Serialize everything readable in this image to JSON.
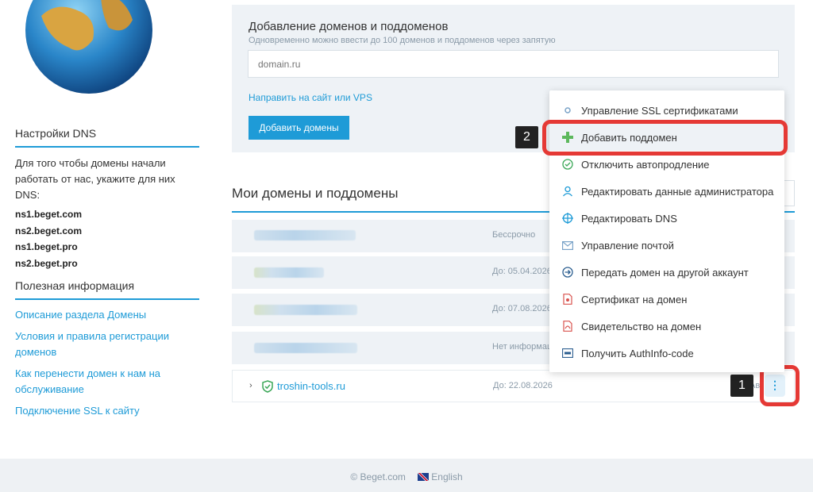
{
  "sidebar": {
    "dns_title": "Настройки DNS",
    "dns_text": "Для того чтобы домены начали работать от нас, укажите для них DNS:",
    "nameservers": [
      "ns1.beget.com",
      "ns2.beget.com",
      "ns1.beget.pro",
      "ns2.beget.pro"
    ],
    "info_title": "Полезная информация",
    "links": [
      "Описание раздела Домены",
      "Условия и правила регистрации доменов",
      "Как перенести домен к нам на обслуживание",
      "Подключение SSL к сайту"
    ]
  },
  "add_panel": {
    "title": "Добавление доменов и поддоменов",
    "subtitle": "Одновременно можно ввести до 100 доменов и поддоменов через запятую",
    "input_placeholder": "domain.ru",
    "redirect_link": "Направить на сайт или VPS",
    "add_button": "Добавить домены"
  },
  "domains": {
    "title": "Мои домены и поддомены",
    "rows": [
      {
        "status": "Бессрочно"
      },
      {
        "status": "До: 05.04.2026"
      },
      {
        "status": "До: 07.08.2026"
      },
      {
        "status": "Нет информации"
      }
    ],
    "last_row": {
      "name": "troshin-tools.ru",
      "status": "До: 22.08.2026",
      "partial": "Авт"
    }
  },
  "menu": {
    "items": [
      {
        "label": "Управление SSL сертификатами",
        "icon": "ssl-icon"
      },
      {
        "label": "Добавить поддомен",
        "icon": "plus-icon"
      },
      {
        "label": "Отключить автопродление",
        "icon": "check-circle-icon"
      },
      {
        "label": "Редактировать данные администратора",
        "icon": "user-icon"
      },
      {
        "label": "Редактировать DNS",
        "icon": "crosshair-icon"
      },
      {
        "label": "Управление почтой",
        "icon": "envelope-icon"
      },
      {
        "label": "Передать домен на другой аккаунт",
        "icon": "transfer-icon"
      },
      {
        "label": "Сертификат на домен",
        "icon": "certificate-icon"
      },
      {
        "label": "Свидетельство на домен",
        "icon": "pdf-icon"
      },
      {
        "label": "Получить AuthInfo-code",
        "icon": "authinfo-icon"
      }
    ]
  },
  "annotations": {
    "badge1": "1",
    "badge2": "2"
  },
  "footer": {
    "copyright": "© Beget.com",
    "language": "English"
  },
  "colors": {
    "accent": "#1e9bd7",
    "panel": "#eef2f6",
    "highlight_ring": "#e53935"
  }
}
